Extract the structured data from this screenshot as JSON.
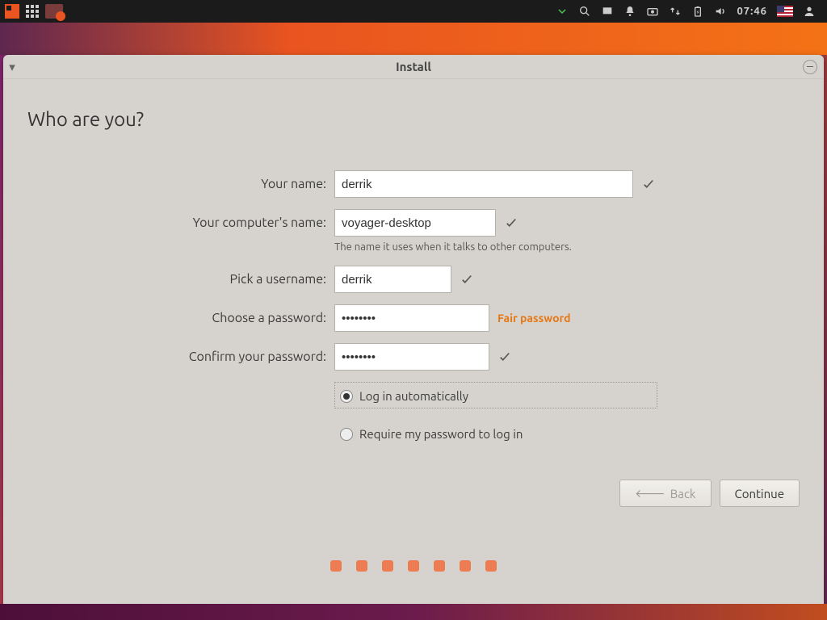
{
  "panel": {
    "time": "07:46"
  },
  "window": {
    "title": "Install"
  },
  "page": {
    "heading": "Who are you?",
    "fields": {
      "name": {
        "label": "Your name:",
        "value": "derrik"
      },
      "host": {
        "label": "Your computer's name:",
        "value": "voyager-desktop",
        "hint": "The name it uses when it talks to other computers."
      },
      "user": {
        "label": "Pick a username:",
        "value": "derrik"
      },
      "pw": {
        "label": "Choose a password:",
        "value": "••••••••",
        "feedback": "Fair password"
      },
      "pw2": {
        "label": "Confirm your password:",
        "value": "••••••••"
      }
    },
    "login": {
      "auto": "Log in automatically",
      "require": "Require my password to log in",
      "selected": "auto"
    },
    "buttons": {
      "back": "Back",
      "continue": "Continue"
    }
  }
}
